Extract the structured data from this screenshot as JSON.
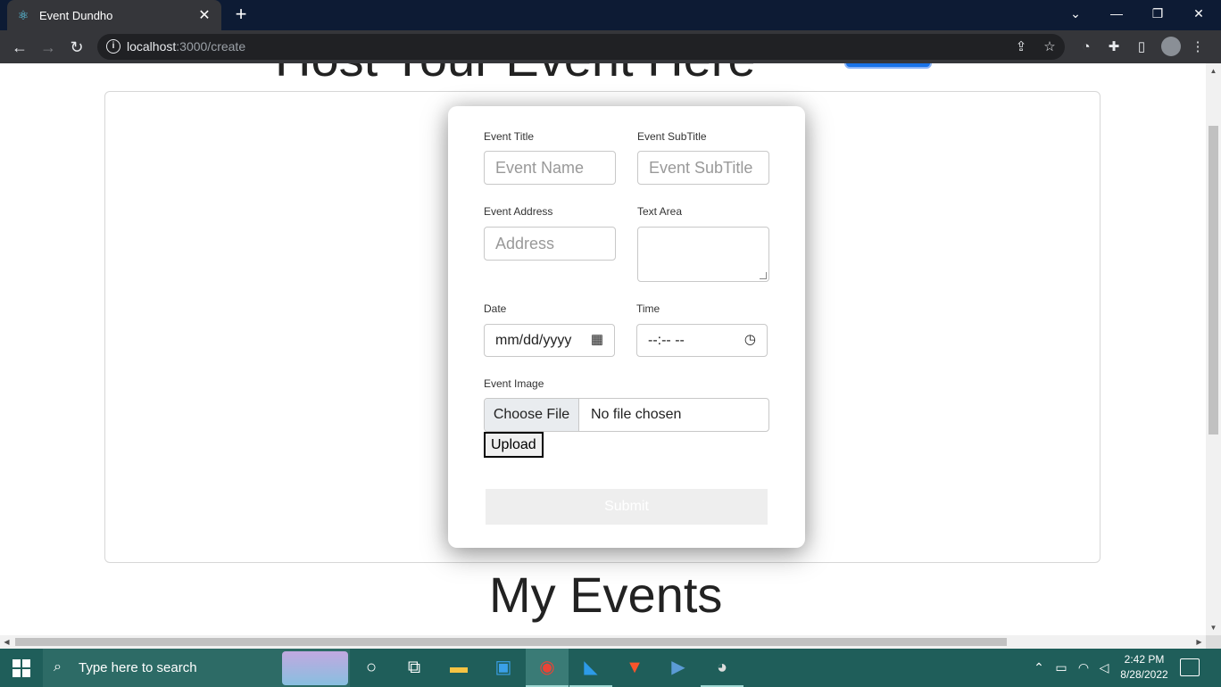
{
  "browser": {
    "tab_title": "Event Dundho",
    "tab_close": "✕",
    "new_tab": "+",
    "url_host": "localhost",
    "url_rest": ":3000/create"
  },
  "page": {
    "host_title": "Host Your Event Here",
    "my_events_title": "My Events"
  },
  "form": {
    "event_title_label": "Event Title",
    "event_title_placeholder": "Event Name",
    "event_subtitle_label": "Event SubTitle",
    "event_subtitle_placeholder": "Event SubTitle",
    "event_address_label": "Event Address",
    "event_address_placeholder": "Address",
    "text_area_label": "Text Area",
    "date_label": "Date",
    "date_value": "mm/dd/yyyy",
    "time_label": "Time",
    "time_value": "--:-- --",
    "event_image_label": "Event Image",
    "choose_file": "Choose File",
    "no_file": "No file chosen",
    "upload": "Upload",
    "submit": "Submit"
  },
  "taskbar": {
    "search_placeholder": "Type here to search",
    "time": "2:42 PM",
    "date": "8/28/2022"
  },
  "colors": {
    "title_bar": "#0d1b34",
    "toolbar": "#35363a",
    "taskbar": "#1f5e5a",
    "accent": "#1a73e8"
  }
}
